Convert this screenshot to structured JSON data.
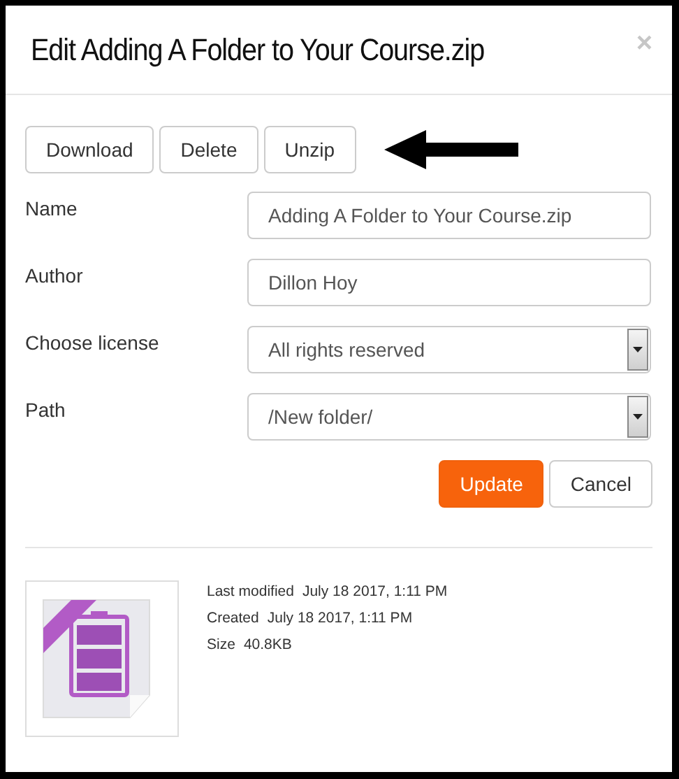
{
  "dialog": {
    "title": "Edit Adding A Folder to Your Course.zip",
    "close": "×"
  },
  "toolbar_buttons": [
    "Download",
    "Delete",
    "Unzip"
  ],
  "fields": [
    {
      "kind": "text",
      "label": "Name",
      "value": "Adding A Folder to Your Course.zip"
    },
    {
      "kind": "text",
      "label": "Author",
      "value": "Dillon Hoy"
    },
    {
      "kind": "select",
      "label": "Choose license",
      "value": "All rights reserved"
    },
    {
      "kind": "select",
      "label": "Path",
      "value": "/New folder/"
    }
  ],
  "actions": [
    {
      "kind": "primary",
      "label": "Update"
    },
    {
      "kind": "default",
      "label": "Cancel"
    }
  ],
  "file_info": [
    {
      "label": "Last modified",
      "value": "July 18 2017, 1:11 PM"
    },
    {
      "label": "Created",
      "value": "July 18 2017, 1:11 PM"
    },
    {
      "label": "Size",
      "value": "40.8KB"
    }
  ]
}
